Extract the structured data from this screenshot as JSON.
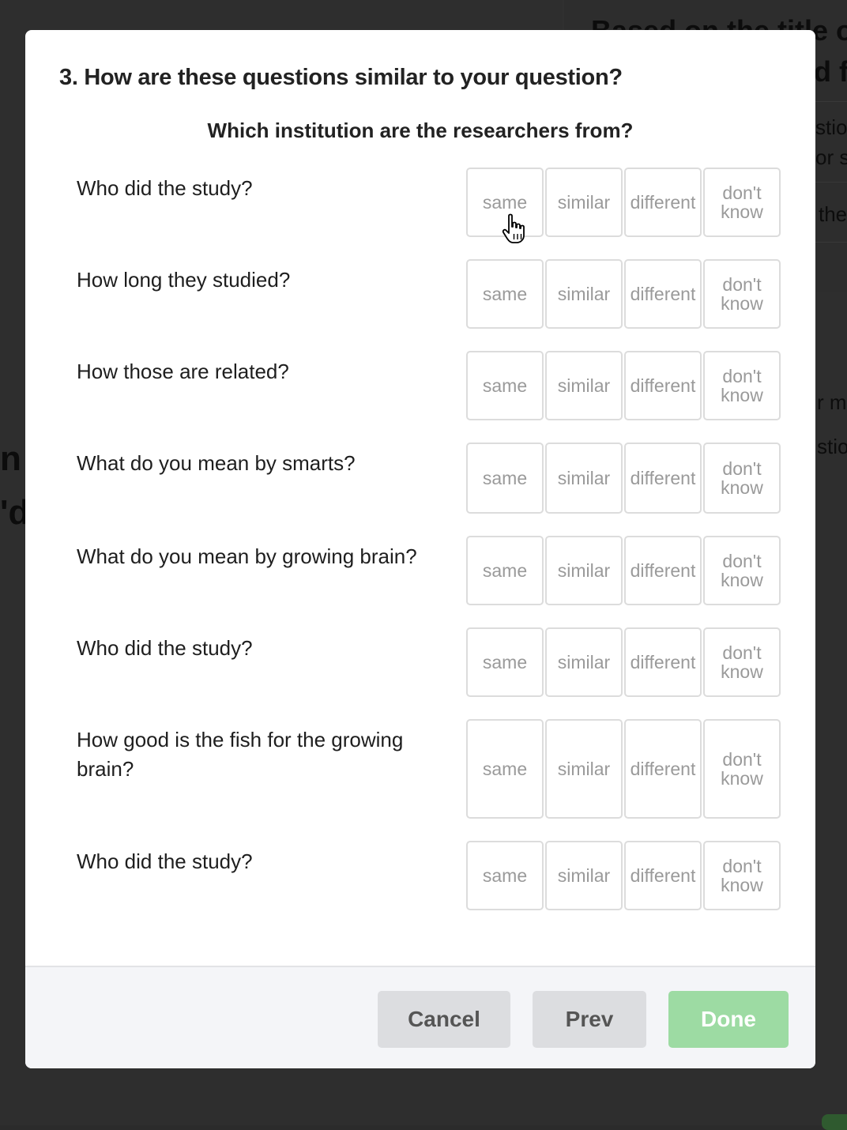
{
  "background": {
    "right_fragments": [
      "Based on the title of",
      "d fr",
      "stio",
      "or s",
      "the",
      "r mo",
      "stio"
    ],
    "left_fragments": [
      "n",
      "'d"
    ]
  },
  "modal": {
    "title": "3. How are these questions similar to your question?",
    "target_question": "Which institution are the researchers from?",
    "options": [
      "same",
      "similar",
      "different",
      "don't know"
    ],
    "rows": [
      {
        "question": "Who did the study?"
      },
      {
        "question": "How long they studied?"
      },
      {
        "question": "How those are related?"
      },
      {
        "question": "What do you mean by smarts?"
      },
      {
        "question": "What do you mean by growing brain?"
      },
      {
        "question": "Who did the study?"
      },
      {
        "question": "How good is the fish for the growing brain?"
      },
      {
        "question": "Who did the study?"
      }
    ],
    "footer": {
      "cancel_label": "Cancel",
      "prev_label": "Prev",
      "done_label": "Done"
    }
  },
  "colors": {
    "overlay": "#2b2b2b",
    "option_border": "#dcdcdc",
    "option_text": "#9a9a9a",
    "done_button": "#9ddba3",
    "secondary_button": "#dcdde0"
  },
  "icons": {
    "cursor": "hand-pointer-icon"
  }
}
